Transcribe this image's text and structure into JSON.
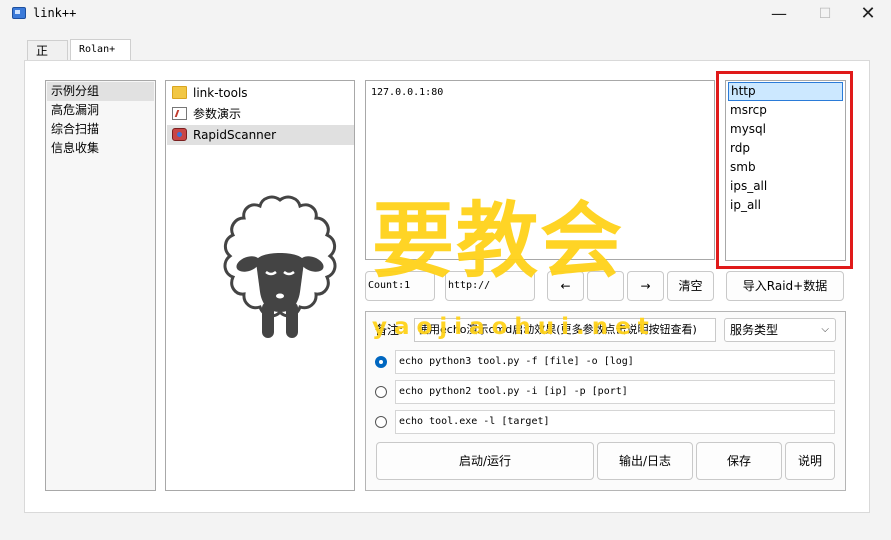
{
  "window": {
    "title": "link++",
    "minimize": "—",
    "maximize": "☐",
    "close": "✕"
  },
  "tabs": [
    {
      "label": "正则"
    },
    {
      "label": "Rolan+"
    }
  ],
  "groups": [
    {
      "label": "示例分组"
    },
    {
      "label": "高危漏洞"
    },
    {
      "label": "综合扫描"
    },
    {
      "label": "信息收集"
    }
  ],
  "tools": [
    {
      "label": "link-tools",
      "icon": "folder-icon"
    },
    {
      "label": "参数演示",
      "icon": "document-icon"
    },
    {
      "label": "RapidScanner",
      "icon": "scanner-icon"
    }
  ],
  "targets": {
    "text": "127.0.0.1:80"
  },
  "services": [
    {
      "label": "http"
    },
    {
      "label": "msrcp"
    },
    {
      "label": "mysql"
    },
    {
      "label": "rdp"
    },
    {
      "label": "smb"
    },
    {
      "label": "ips_all"
    },
    {
      "label": "ip_all"
    }
  ],
  "toolbar": {
    "count_field": "Count:1",
    "prefix_field": "http://",
    "arrow_left": "←",
    "blank1": "",
    "blank2": "",
    "arrow_right": "→",
    "clear": "清空",
    "import": "导入Raid+数据"
  },
  "command": {
    "remark_label": "备注:",
    "remark_value": "使用echo演示cmd启动效果(更多参数点击说明按钮查看)",
    "service_type": "服务类型",
    "options": [
      "echo python3 tool.py -f [file] -o [log]",
      "echo python2 tool.py -i [ip] -p [port]",
      "echo tool.exe -l [target]"
    ]
  },
  "actions": {
    "run": "启动/运行",
    "output": "输出/日志",
    "save": "保存",
    "help": "说明"
  },
  "watermark": {
    "main": "要教会",
    "sub": "yaojiaohui.net"
  }
}
